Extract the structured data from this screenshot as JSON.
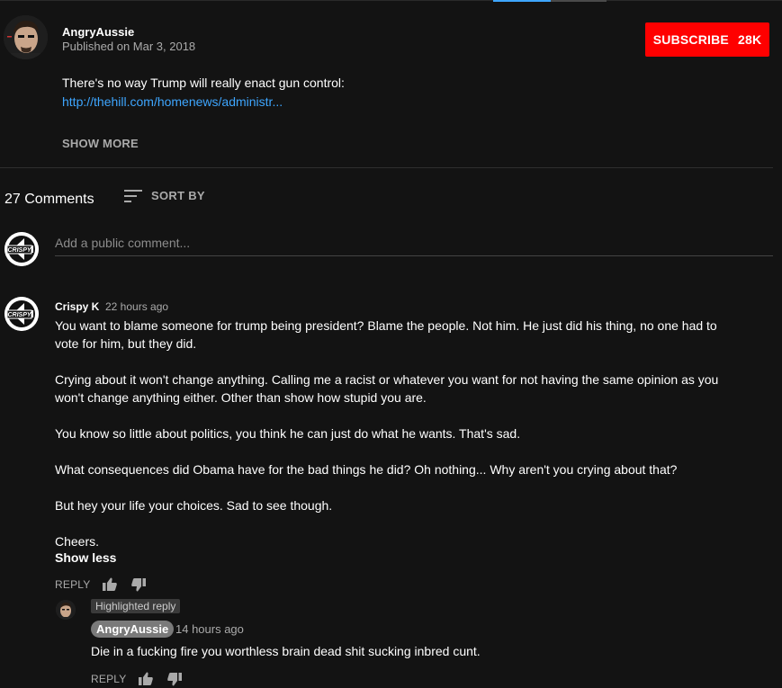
{
  "video": {
    "channel_name": "AngryAussie",
    "published": "Published on Mar 3, 2018",
    "subscribe_label": "SUBSCRIBE",
    "subscriber_count": "28K",
    "description_line": "There's no way Trump will really enact gun control:",
    "description_link": "http://thehill.com/homenews/administr...",
    "show_more_label": "SHOW MORE"
  },
  "comments_header": {
    "count_label": "27 Comments",
    "sort_label": "SORT BY"
  },
  "add_comment": {
    "placeholder": "Add a public comment...",
    "avatar_text": "CRISPY"
  },
  "comment": {
    "author": "Crispy K",
    "time": "22 hours ago",
    "avatar_text": "CRISPY",
    "paragraphs": [
      "You want to blame someone for trump being president? Blame the people. Not him. He just did his thing, no one had to vote for him, but they did.",
      "Crying about it won't change anything. Calling me a racist or whatever you want for not having the same opinion as you won't change anything either. Other than show how stupid you are.",
      "You know so little about politics, you think he can just do what he wants. That's sad.",
      "What consequences did Obama have for the bad things he did? Oh nothing... Why aren't you crying about that?",
      "But hey your life your choices. Sad to see though.",
      "Cheers."
    ],
    "show_less_label": "Show less",
    "reply_label": "REPLY"
  },
  "reply": {
    "badge": "Highlighted reply",
    "author": "AngryAussie",
    "time": "14 hours ago",
    "text": "Die in a fucking fire you worthless brain dead shit sucking inbred cunt.",
    "reply_label": "REPLY"
  },
  "colors": {
    "background": "#131313",
    "subscribe": "#ff0000",
    "link": "#3ea6ff",
    "secondary_text": "#aaaaaa"
  }
}
